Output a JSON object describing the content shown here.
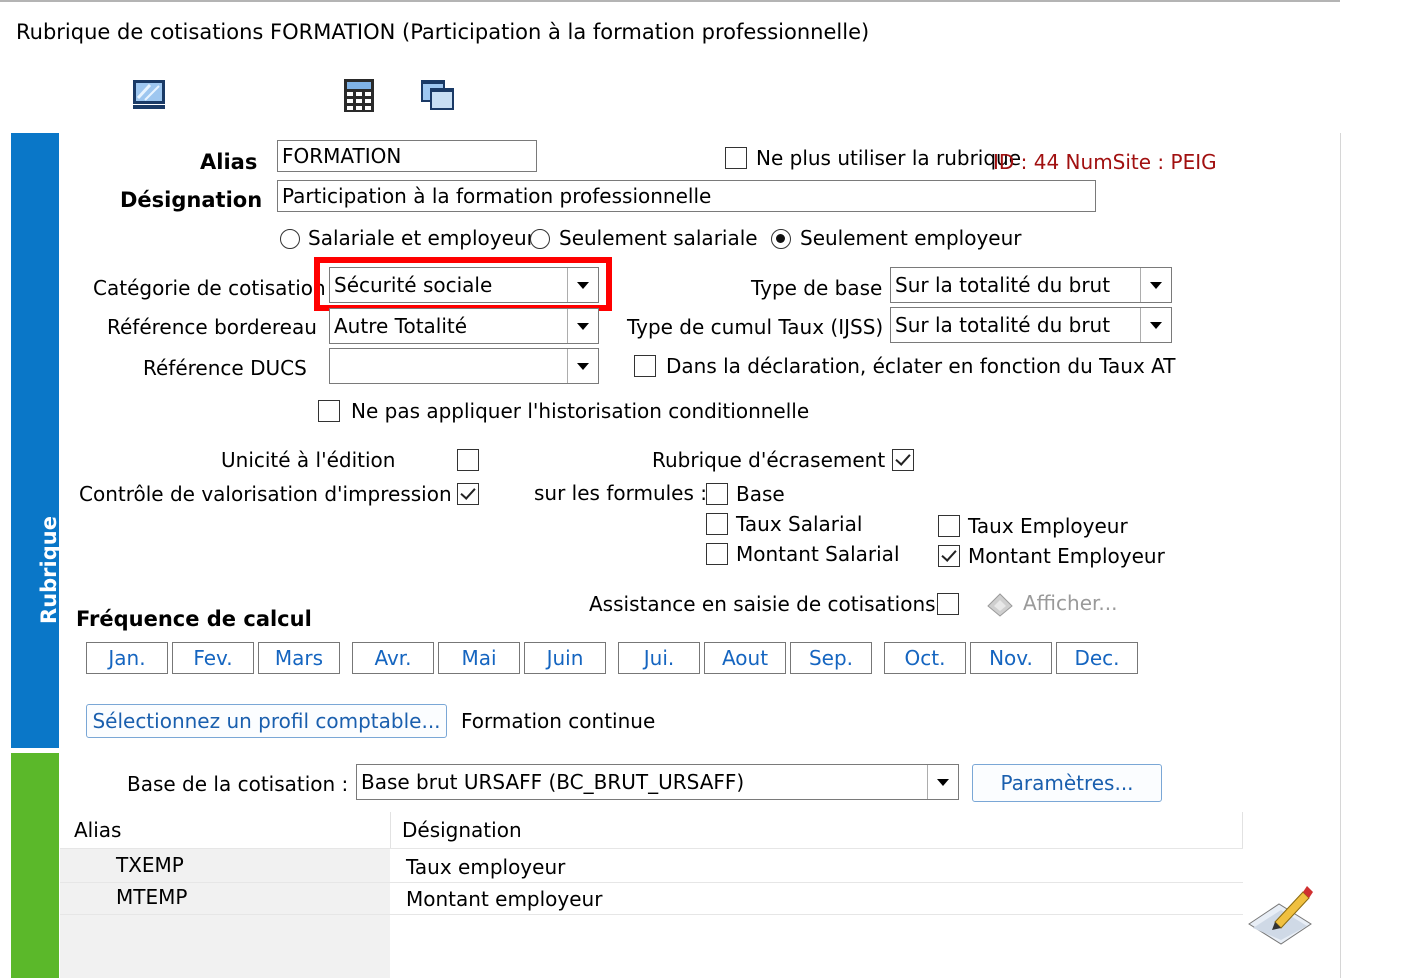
{
  "window": {
    "title": "Rubrique de cotisations FORMATION (Participation à la formation professionnelle)"
  },
  "toolbar": {
    "icons": [
      "monitor-icon",
      "calculator-icon",
      "windows-icon"
    ]
  },
  "side_tabs": {
    "rubrique": "Rubrique"
  },
  "form": {
    "alias_label": "Alias",
    "alias_value": "FORMATION",
    "designation_label": "Désignation",
    "designation_value": "Participation à la formation professionnelle",
    "ne_plus_utiliser_label": "Ne plus utiliser la rubrique",
    "id_info": "ID : 44 NumSite : PEIG",
    "radios": {
      "salariale_employeur": "Salariale et employeur",
      "seulement_salariale": "Seulement salariale",
      "seulement_employeur": "Seulement employeur",
      "selected": "seulement_employeur"
    },
    "categorie_label": "Catégorie de cotisation",
    "categorie_value": "Sécurité sociale",
    "ref_bordereau_label": "Référence bordereau",
    "ref_bordereau_value": "Autre Totalité",
    "ref_ducs_label": "Référence DUCS",
    "ref_ducs_value": "",
    "type_base_label": "Type de base",
    "type_base_value": "Sur la totalité du brut",
    "type_cumul_label": "Type de cumul Taux (IJSS)",
    "type_cumul_value": "Sur la totalité du brut",
    "eclater_label": "Dans la déclaration, éclater en fonction du Taux AT",
    "historisation_label": "Ne pas appliquer l'historisation conditionnelle",
    "unicite_label": "Unicité à l'édition",
    "controle_label": "Contrôle de valorisation d'impression",
    "ecrasement_label": "Rubrique d'écrasement",
    "sur_formules_label": "sur les formules :",
    "f_base": "Base",
    "f_taux_salarial": "Taux Salarial",
    "f_montant_salarial": "Montant Salarial",
    "f_taux_employeur": "Taux Employeur",
    "f_montant_employeur": "Montant Employeur",
    "assistance_label": "Assistance en saisie de cotisations",
    "afficher_label": "Afficher..."
  },
  "frequence": {
    "title": "Fréquence de calcul",
    "months": [
      "Jan.",
      "Fev.",
      "Mars",
      "Avr.",
      "Mai",
      "Juin",
      "Jui.",
      "Aout",
      "Sep.",
      "Oct.",
      "Nov.",
      "Dec."
    ]
  },
  "profil": {
    "button_label": "Sélectionnez un profil comptable...",
    "value": "Formation continue"
  },
  "base": {
    "label": "Base de la cotisation :",
    "value": "Base brut URSAFF (BC_BRUT_URSAFF)",
    "parametres_label": "Paramètres..."
  },
  "table": {
    "columns": [
      "Alias",
      "Désignation"
    ],
    "rows": [
      {
        "alias": "TXEMP",
        "designation": "Taux employeur"
      },
      {
        "alias": "MTEMP",
        "designation": "Montant employeur"
      }
    ]
  }
}
